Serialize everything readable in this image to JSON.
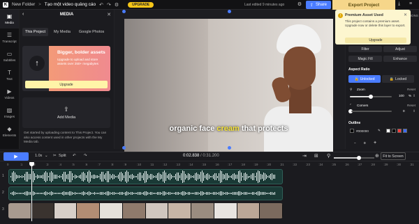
{
  "topbar": {
    "folder": "New Folder",
    "separator": ">",
    "project_name": "Tạo một video quảng cáo",
    "upgrade": "UPGRADE",
    "saved": "Last edited 9 minutes ago",
    "share": "Share",
    "export": "Export Project"
  },
  "leftnav": [
    {
      "label": "Media",
      "icon": "media-icon"
    },
    {
      "label": "Transcript",
      "icon": "transcript-icon"
    },
    {
      "label": "Subtitles",
      "icon": "subtitles-icon"
    },
    {
      "label": "Text",
      "icon": "text-icon"
    },
    {
      "label": "Videos",
      "icon": "videos-icon"
    },
    {
      "label": "Images",
      "icon": "images-icon"
    },
    {
      "label": "Elements",
      "icon": "elements-icon"
    }
  ],
  "media": {
    "title": "MEDIA",
    "tabs": [
      "This Project",
      "My Media",
      "Google Photos"
    ],
    "promo_title": "Bigger, bolder assets",
    "promo_desc": "Upgrade to upload and store assets over 250+ megabytes",
    "promo_button": "Upgrade",
    "add_media": "Add Media",
    "hint": "Get started by uploading content to This Project. You can also access content used in other projects with the My Media tab."
  },
  "caption": {
    "before": "organic face ",
    "highlight": "cream",
    "after": " that protects"
  },
  "popup": {
    "title": "Premium Asset Used",
    "body": "This project contains a premium asset. Upgrade now or delete this layer to export.",
    "button": "Upgrade"
  },
  "rightpanel": {
    "tab_partial": "SITIONS",
    "filter": "Filter",
    "adjust": "Adjust",
    "magic_fill": "Magic Fill",
    "enhance": "Enhance",
    "aspect_ratio": "Aspect Ratio",
    "unlocked": "Unlocked",
    "locked": "Locked",
    "zoom_label": "Zoom",
    "zoom_reset": "Reset",
    "zoom_value": "100",
    "zoom_unit": "%",
    "corners_label": "Corners",
    "corners_reset": "Reset",
    "corners_value": "0",
    "outline_label": "Outline",
    "outline_color": "#000000",
    "stepper_value": "0",
    "colors": {
      "accent": "#4a7cff",
      "export": "#f6d68a",
      "popup": "#fdf6cf",
      "highlight": "#f5e33a"
    }
  },
  "timeline": {
    "speed": "1.0x",
    "split": "Split",
    "time_current": "0:02.838",
    "time_total": "/ 0:31.200",
    "fit": "Fit to Screen",
    "ruler": [
      "0",
      ":1",
      ":2",
      ":3",
      ":4",
      ":5",
      ":6",
      ":7",
      ":8",
      ":9",
      ":10",
      ":11",
      ":12",
      ":13",
      ":14",
      ":15",
      ":16",
      ":17",
      ":18",
      ":19",
      ":20",
      ":21",
      ":22",
      ":23",
      ":24",
      ":25",
      ":26",
      ":27",
      ":28",
      ":29",
      ":30",
      ":31"
    ],
    "tracks": [
      "1",
      "2",
      "3"
    ]
  }
}
